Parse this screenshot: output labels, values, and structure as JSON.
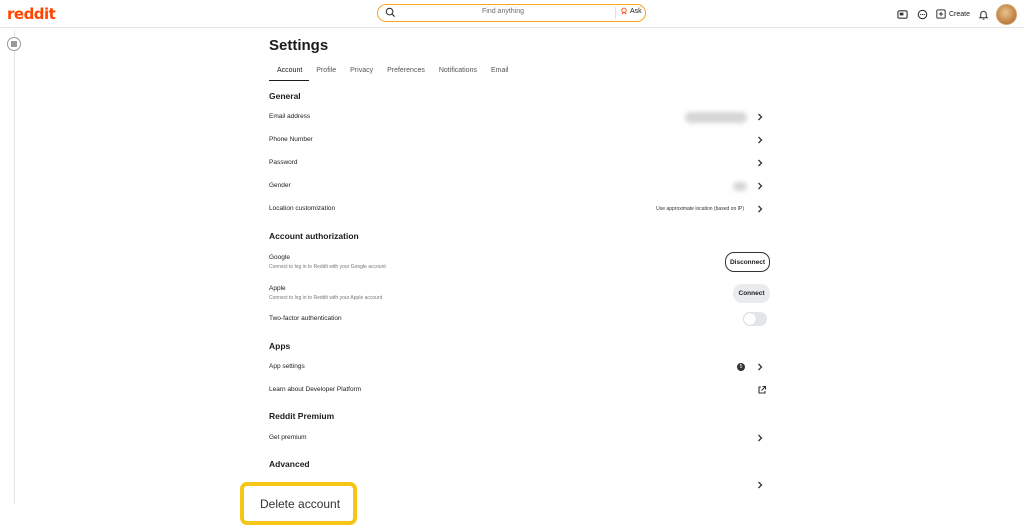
{
  "app": {
    "logo": "reddit"
  },
  "header": {
    "search_placeholder": "Find anything",
    "ask_label": "Ask",
    "create_label": "Create"
  },
  "page": {
    "title": "Settings"
  },
  "tabs": [
    {
      "label": "Account",
      "active": true
    },
    {
      "label": "Profile"
    },
    {
      "label": "Privacy"
    },
    {
      "label": "Preferences"
    },
    {
      "label": "Notifications"
    },
    {
      "label": "Email"
    }
  ],
  "sections": {
    "general": "General",
    "account_authorization": "Account authorization",
    "apps": "Apps",
    "premium": "Reddit Premium",
    "advanced": "Advanced"
  },
  "general": {
    "email": "Email address",
    "phone": "Phone Number",
    "password": "Password",
    "gender": "Gender",
    "location": "Location customization",
    "location_value": "Use approximate location (based on IP)"
  },
  "auth": {
    "google": {
      "label": "Google",
      "sub": "Connect to log in to Reddit with your Google account",
      "button": "Disconnect"
    },
    "apple": {
      "label": "Apple",
      "sub": "Connect to log in to Reddit with your Apple account",
      "button": "Connect"
    },
    "two_factor": {
      "label": "Two-factor authentication",
      "enabled": false
    }
  },
  "apps": {
    "settings": "App settings",
    "settings_count": "5",
    "developer": "Learn about Developer Platform"
  },
  "premium": {
    "get": "Get premium"
  },
  "advanced": {
    "delete": "Delete account"
  },
  "colors": {
    "brand": "#ff4500",
    "highlight": "#f5c518",
    "search_border": "#f5a623"
  }
}
